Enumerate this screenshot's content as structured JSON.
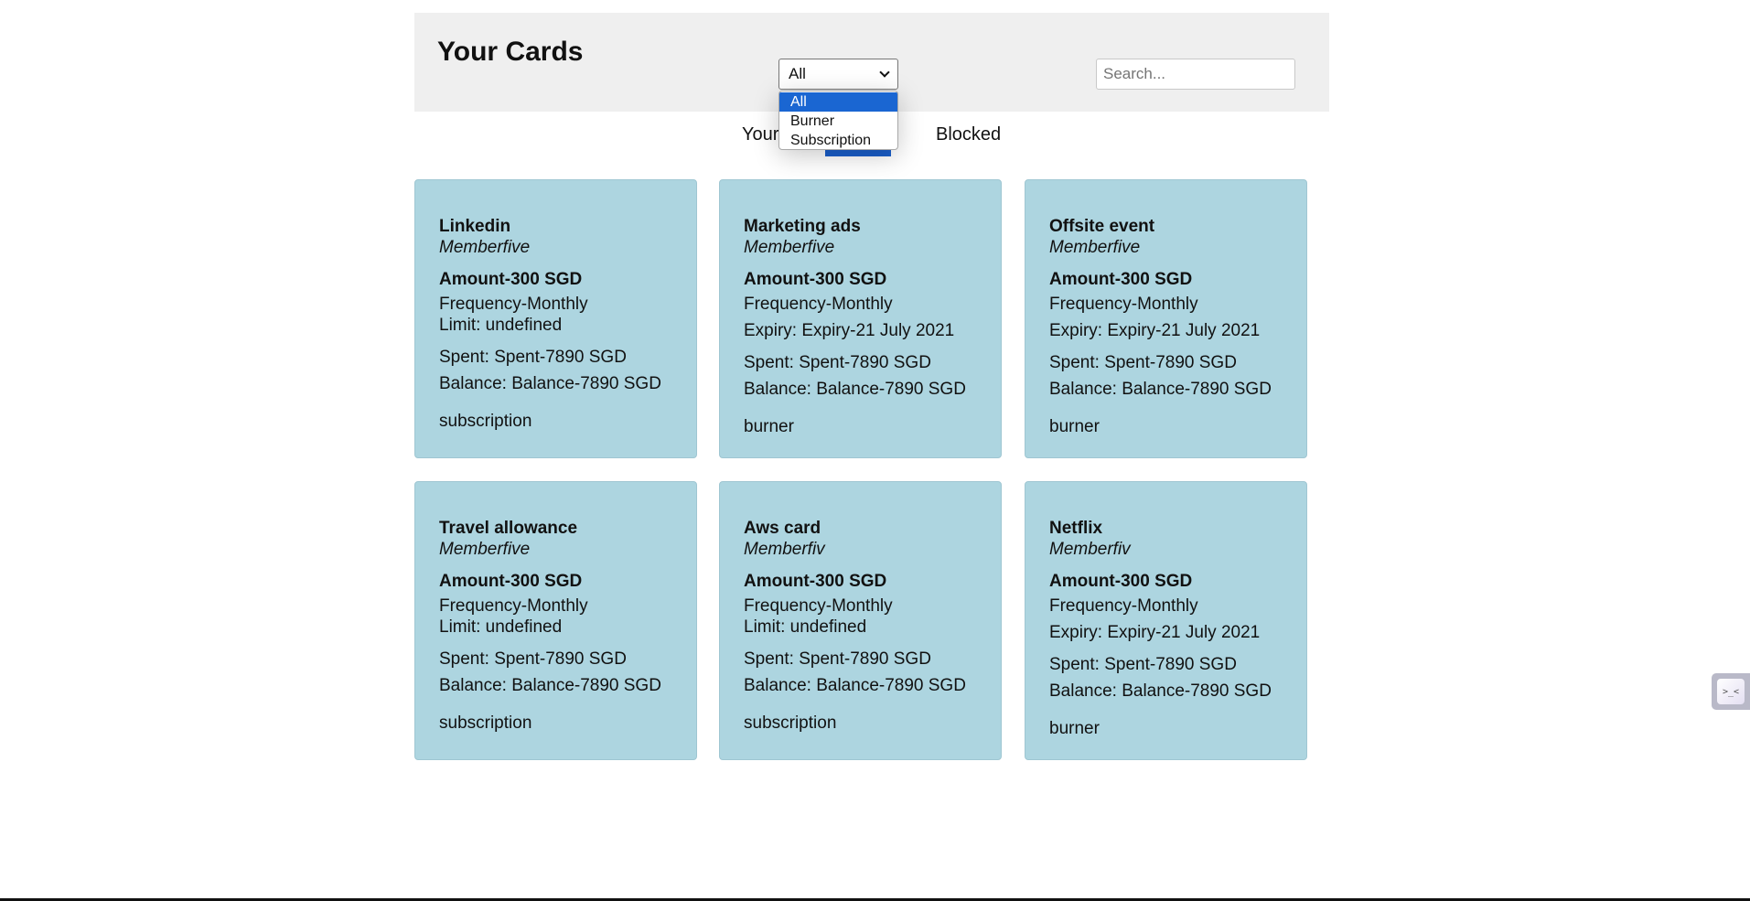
{
  "header": {
    "title": "Your Cards",
    "filter": {
      "selected": "All",
      "options": [
        "All",
        "Burner",
        "Subscription"
      ]
    },
    "search": {
      "placeholder": "Search...",
      "value": ""
    }
  },
  "tabs": {
    "yours_label": "Your",
    "blocked_label": "Blocked"
  },
  "cards": [
    {
      "title": "Linkedin",
      "member": "Memberfive",
      "amount": "Amount-300 SGD",
      "frequency": "Frequency-Monthly",
      "limit": "Limit: undefined",
      "spent": "Spent: Spent-7890 SGD",
      "balance": "Balance: Balance-7890 SGD",
      "type": "subscription"
    },
    {
      "title": "Marketing ads",
      "member": "Memberfive",
      "amount": "Amount-300 SGD",
      "frequency": "Frequency-Monthly",
      "expiry": "Expiry: Expiry-21 July 2021",
      "spent": "Spent: Spent-7890 SGD",
      "balance": "Balance: Balance-7890 SGD",
      "type": "burner"
    },
    {
      "title": "Offsite event",
      "member": "Memberfive",
      "amount": "Amount-300 SGD",
      "frequency": "Frequency-Monthly",
      "expiry": "Expiry: Expiry-21 July 2021",
      "spent": "Spent: Spent-7890 SGD",
      "balance": "Balance: Balance-7890 SGD",
      "type": "burner"
    },
    {
      "title": "Travel allowance",
      "member": "Memberfive",
      "amount": "Amount-300 SGD",
      "frequency": "Frequency-Monthly",
      "limit": "Limit: undefined",
      "spent": "Spent: Spent-7890 SGD",
      "balance": "Balance: Balance-7890 SGD",
      "type": "subscription"
    },
    {
      "title": "Aws card",
      "member": "Memberfiv",
      "amount": "Amount-300 SGD",
      "frequency": "Frequency-Monthly",
      "limit": "Limit: undefined",
      "spent": "Spent: Spent-7890 SGD",
      "balance": "Balance: Balance-7890 SGD",
      "type": "subscription"
    },
    {
      "title": "Netflix",
      "member": "Memberfiv",
      "amount": "Amount-300 SGD",
      "frequency": "Frequency-Monthly",
      "expiry": "Expiry: Expiry-21 July 2021",
      "spent": "Spent: Spent-7890 SGD",
      "balance": "Balance: Balance-7890 SGD",
      "type": "burner"
    }
  ],
  "widget": {
    "icon": "terminal-icon",
    "glyph": ">_<"
  },
  "colors": {
    "card_bg": "#add5e0",
    "header_bg": "#efefef",
    "accent": "#1a66d2"
  }
}
